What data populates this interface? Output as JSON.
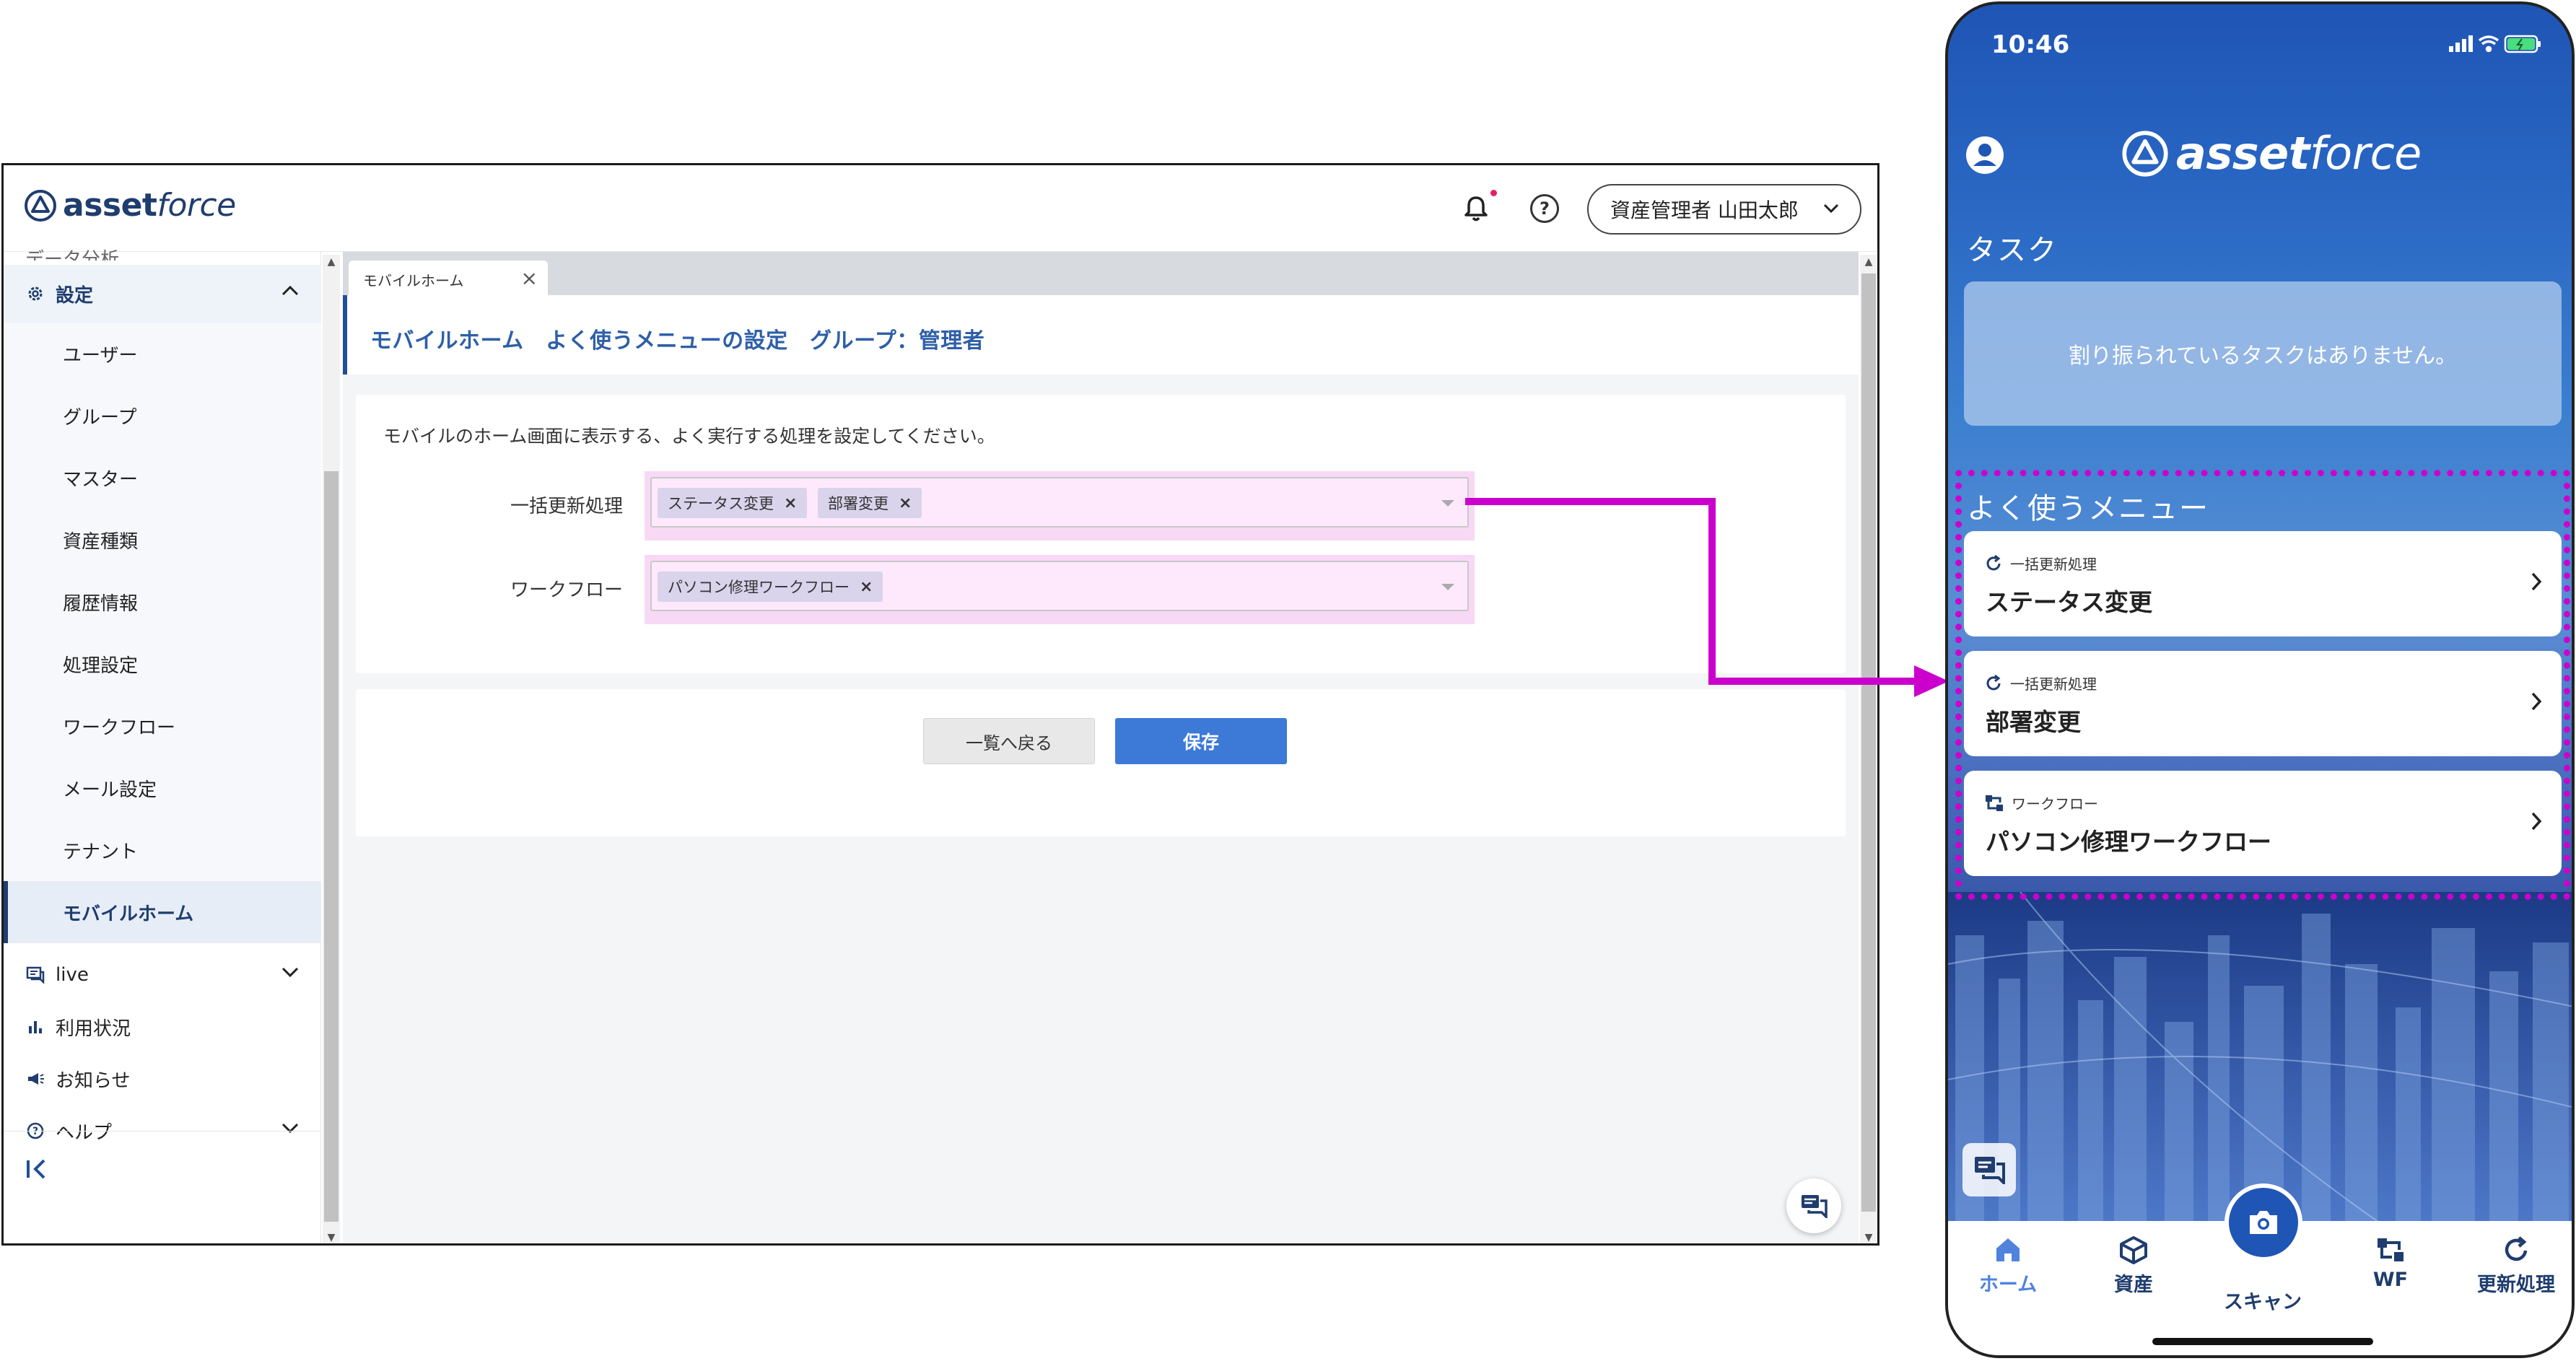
{
  "desktop": {
    "logo": {
      "word1": "asset",
      "word2": "force"
    },
    "header": {
      "user_label": "資産管理者 山田太郎"
    },
    "sidebar": {
      "cut_item": "データ分析",
      "settings_label": "設定",
      "settings_items": [
        "ユーザー",
        "グループ",
        "マスター",
        "資産種類",
        "履歴情報",
        "処理設定",
        "ワークフロー",
        "メール設定",
        "テナント",
        "モバイルホーム"
      ],
      "sections": [
        "live",
        "利用状況",
        "お知らせ",
        "ヘルプ"
      ]
    },
    "tab": {
      "label": "モバイルホーム"
    },
    "page_title": "モバイルホーム　よく使うメニューの設定　グループ：管理者",
    "form": {
      "description": "モバイルのホーム画面に表示する、よく実行する処理を設定してください。",
      "bulk_label": "一括更新処理",
      "bulk_chips": [
        "ステータス変更",
        "部署変更"
      ],
      "workflow_label": "ワークフロー",
      "workflow_chips": [
        "パソコン修理ワークフロー"
      ]
    },
    "actions": {
      "back_label": "一覧へ戻る",
      "save_label": "保存"
    }
  },
  "phone": {
    "time": "10:46",
    "logo": {
      "word1": "asset",
      "word2": "force"
    },
    "task_heading": "タスク",
    "task_empty": "割り振られているタスクはありません。",
    "menu_heading": "よく使うメニュー",
    "menu_items": [
      {
        "category": "一括更新処理",
        "name": "ステータス変更"
      },
      {
        "category": "一括更新処理",
        "name": "部署変更"
      },
      {
        "category": "ワークフロー",
        "name": "パソコン修理ワークフロー"
      }
    ],
    "tabs": [
      "ホーム",
      "資産",
      "スキャン",
      "WF",
      "更新処理"
    ]
  },
  "colors": {
    "brand": "#1f3d6e",
    "accent": "#3d7ad8",
    "highlight": "#cc00cc",
    "chip_field": "#fde9fb"
  }
}
